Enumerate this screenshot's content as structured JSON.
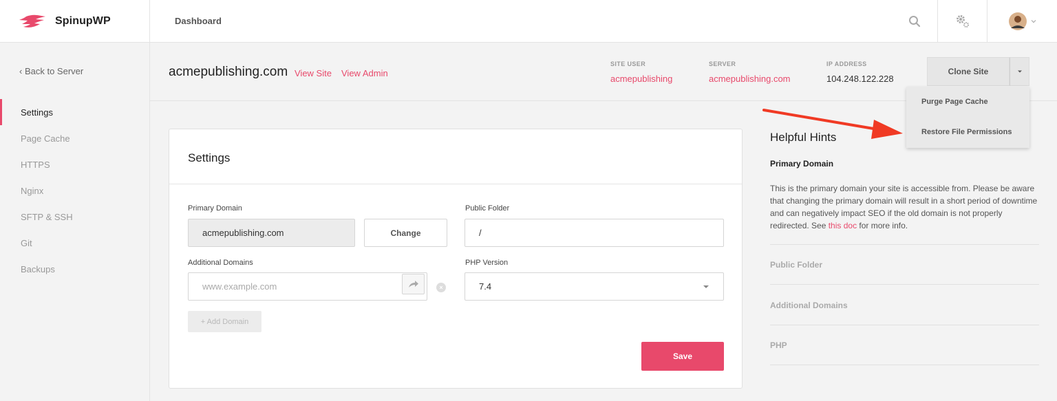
{
  "brand": {
    "name": "SpinupWP",
    "accent": "#e8496b"
  },
  "topbar": {
    "title": "Dashboard"
  },
  "sidebar": {
    "back_label": "Back to Server",
    "items": [
      {
        "label": "Settings",
        "active": true
      },
      {
        "label": "Page Cache"
      },
      {
        "label": "HTTPS"
      },
      {
        "label": "Nginx"
      },
      {
        "label": "SFTP & SSH"
      },
      {
        "label": "Git"
      },
      {
        "label": "Backups"
      }
    ]
  },
  "site": {
    "domain": "acmepublishing.com",
    "view_site": "View Site",
    "view_admin": "View Admin",
    "meta": {
      "site_user_label": "SITE USER",
      "site_user": "acmepublishing",
      "server_label": "SERVER",
      "server": "acmepublishing.com",
      "ip_label": "IP ADDRESS",
      "ip": "104.248.122.228"
    },
    "clone_label": "Clone Site"
  },
  "dropdown": {
    "items": [
      "Purge Page Cache",
      "Restore File Permissions"
    ]
  },
  "settings": {
    "title": "Settings",
    "primary_domain_label": "Primary Domain",
    "primary_domain_value": "acmepublishing.com",
    "change_label": "Change",
    "public_folder_label": "Public Folder",
    "public_folder_value": "/",
    "additional_domains_label": "Additional Domains",
    "additional_domains_placeholder": "www.example.com",
    "add_domain_label": "+ Add Domain",
    "php_version_label": "PHP Version",
    "php_version_value": "7.4",
    "save_label": "Save"
  },
  "hints": {
    "title": "Helpful Hints",
    "open_title": "Primary Domain",
    "body_before": "This is the primary domain your site is accessible from. Please be aware that changing the primary domain will result in a short period of downtime and can negatively impact SEO if the old domain is not properly redirected. See ",
    "body_link": "this doc",
    "body_after": " for more info.",
    "collapsed": [
      "Public Folder",
      "Additional Domains",
      "PHP"
    ]
  }
}
